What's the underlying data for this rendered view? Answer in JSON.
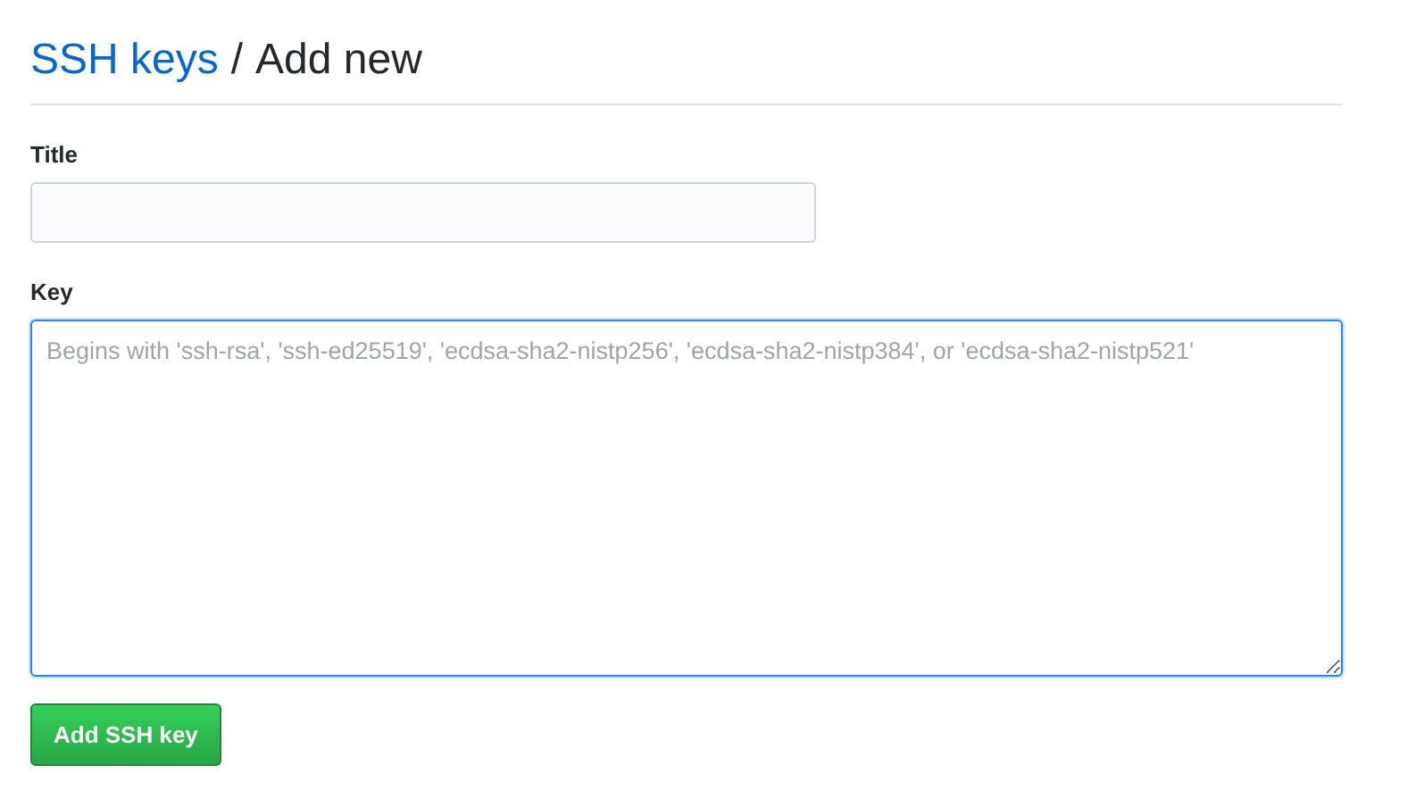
{
  "heading": {
    "link": "SSH keys",
    "separator": "/",
    "title": "Add new"
  },
  "fields": [
    {
      "kind": "input",
      "label": "Title",
      "focused": false
    },
    {
      "kind": "textarea",
      "label": "Key",
      "placeholder": "Begins with 'ssh-rsa', 'ssh-ed25519', 'ecdsa-sha2-nistp256', 'ecdsa-sha2-nistp384', or 'ecdsa-sha2-nistp521'",
      "focused": true
    }
  ],
  "button": "Add SSH key"
}
